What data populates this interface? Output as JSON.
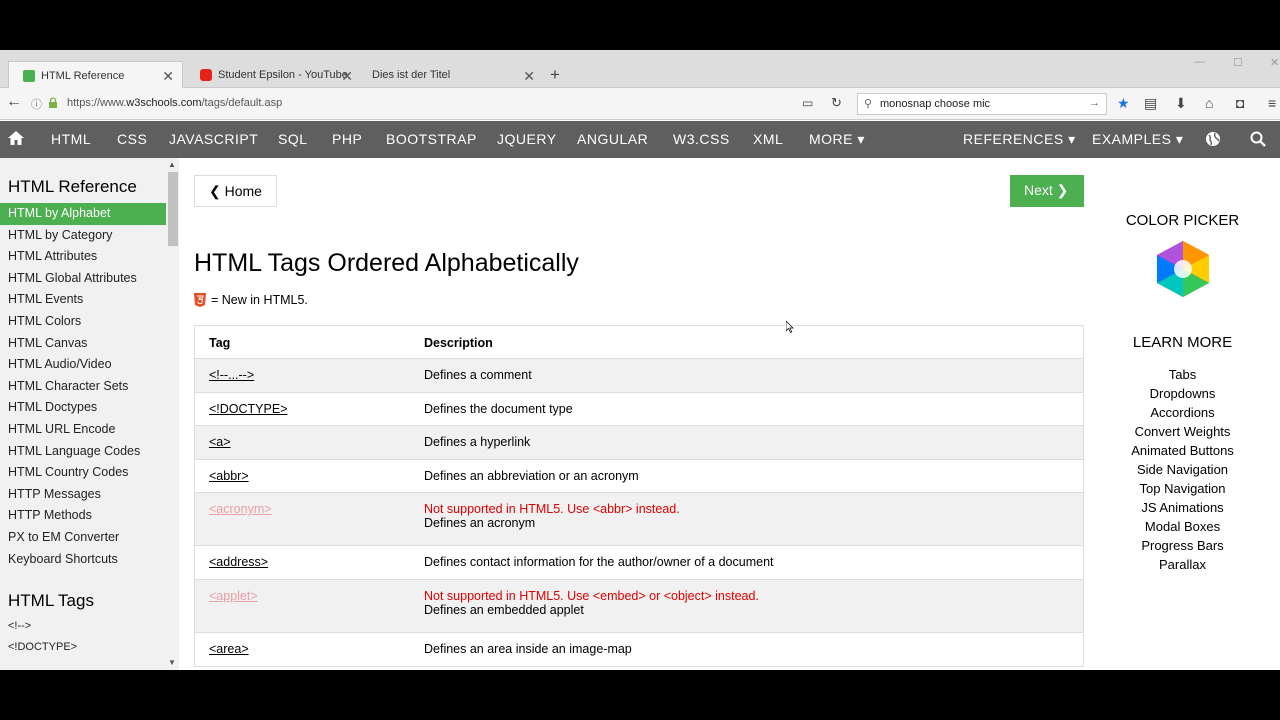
{
  "browser": {
    "tabs": [
      {
        "title": "HTML Reference",
        "favicon_color": "#4caf50"
      },
      {
        "title": "Student Epsilon - YouTube",
        "favicon_color": "#e62117"
      },
      {
        "title": "Dies ist der Titel",
        "favicon_color": ""
      }
    ],
    "url_protocol": "https://www.",
    "url_host": "w3schools.com",
    "url_path": "/tags/default.asp",
    "search_value": "monosnap choose mic"
  },
  "topnav": {
    "items": [
      "HTML",
      "CSS",
      "JAVASCRIPT",
      "SQL",
      "PHP",
      "BOOTSTRAP",
      "JQUERY",
      "ANGULAR",
      "W3.CSS",
      "XML",
      "MORE ▾"
    ],
    "right_items": [
      "REFERENCES ▾",
      "EXAMPLES ▾"
    ]
  },
  "sidebar": {
    "title": "HTML Reference",
    "links": [
      "HTML by Alphabet",
      "HTML by Category",
      "HTML Attributes",
      "HTML Global Attributes",
      "HTML Events",
      "HTML Colors",
      "HTML Canvas",
      "HTML Audio/Video",
      "HTML Character Sets",
      "HTML Doctypes",
      "HTML URL Encode",
      "HTML Language Codes",
      "HTML Country Codes",
      "HTTP Messages",
      "HTTP Methods",
      "PX to EM Converter",
      "Keyboard Shortcuts"
    ],
    "tags_title": "HTML Tags",
    "tags": [
      "<!-->",
      "<!DOCTYPE>"
    ]
  },
  "main": {
    "home_label": "❮ Home",
    "next_label": "Next ❯",
    "title": "HTML Tags Ordered Alphabetically",
    "legend": "= New in HTML5.",
    "table": {
      "headers": [
        "Tag",
        "Description"
      ],
      "rows": [
        {
          "tag": "<!--...-->",
          "desc": "Defines a comment",
          "warn": ""
        },
        {
          "tag": "<!DOCTYPE>",
          "desc": "Defines the document type",
          "warn": ""
        },
        {
          "tag": "<a>",
          "desc": "Defines a hyperlink",
          "warn": ""
        },
        {
          "tag": "<abbr>",
          "desc": "Defines an abbreviation or an acronym",
          "warn": ""
        },
        {
          "tag": "<acronym>",
          "desc": "Defines an acronym",
          "warn": "Not supported in HTML5. Use <abbr> instead."
        },
        {
          "tag": "<address>",
          "desc": "Defines contact information for the author/owner of a document",
          "warn": ""
        },
        {
          "tag": "<applet>",
          "desc": "Defines an embedded applet",
          "warn": "Not supported in HTML5. Use <embed> or <object> instead."
        },
        {
          "tag": "<area>",
          "desc": "Defines an area inside an image-map",
          "warn": ""
        }
      ]
    }
  },
  "rightcol": {
    "color_picker": "COLOR PICKER",
    "learn_more": "LEARN MORE",
    "links": [
      "Tabs",
      "Dropdowns",
      "Accordions",
      "Convert Weights",
      "Animated Buttons",
      "Side Navigation",
      "Top Navigation",
      "JS Animations",
      "Modal Boxes",
      "Progress Bars",
      "Parallax"
    ]
  },
  "colors": {
    "accent": "#4caf50",
    "nav_bg": "#5f5f5f",
    "warn": "#e00000"
  }
}
